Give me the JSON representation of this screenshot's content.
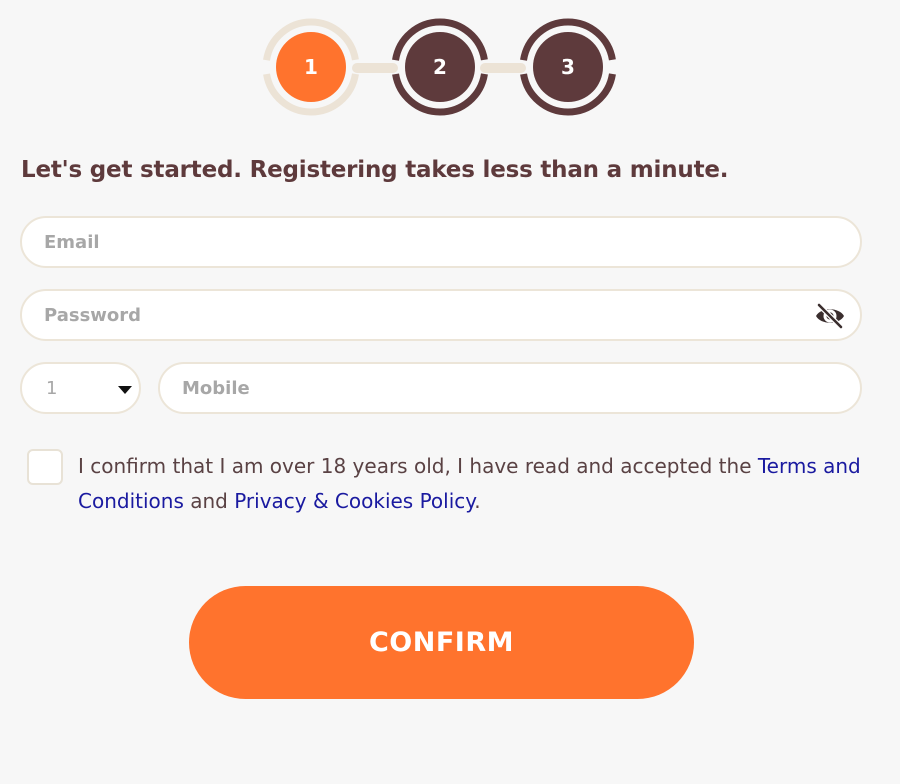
{
  "stepper": {
    "steps": [
      {
        "number": "1",
        "state": "active"
      },
      {
        "number": "2",
        "state": "pending"
      },
      {
        "number": "3",
        "state": "pending"
      }
    ],
    "colors": {
      "active": "#ff732d",
      "active_ring": "#ece3d6",
      "pending": "#5e3a3c",
      "connector": "#ece3d6"
    }
  },
  "heading": "Let's get started. Registering takes less than a minute.",
  "form": {
    "email_placeholder": "Email",
    "password_placeholder": "Password",
    "password_toggle_icon": "eye-slash-icon",
    "country_code_value": "1",
    "mobile_placeholder": "Mobile"
  },
  "consent": {
    "checked": false,
    "text_before": "I confirm that I am over 18 years old, I have read and accepted the ",
    "terms_link": "Terms and Conditions",
    "text_middle": " and ",
    "privacy_link": "Privacy & Cookies Policy",
    "text_after": "."
  },
  "confirm_label": "CONFIRM",
  "colors": {
    "accent": "#ff732d",
    "heading": "#5e3a3c",
    "link": "#1a1aa0",
    "background": "#f7f7f7"
  }
}
